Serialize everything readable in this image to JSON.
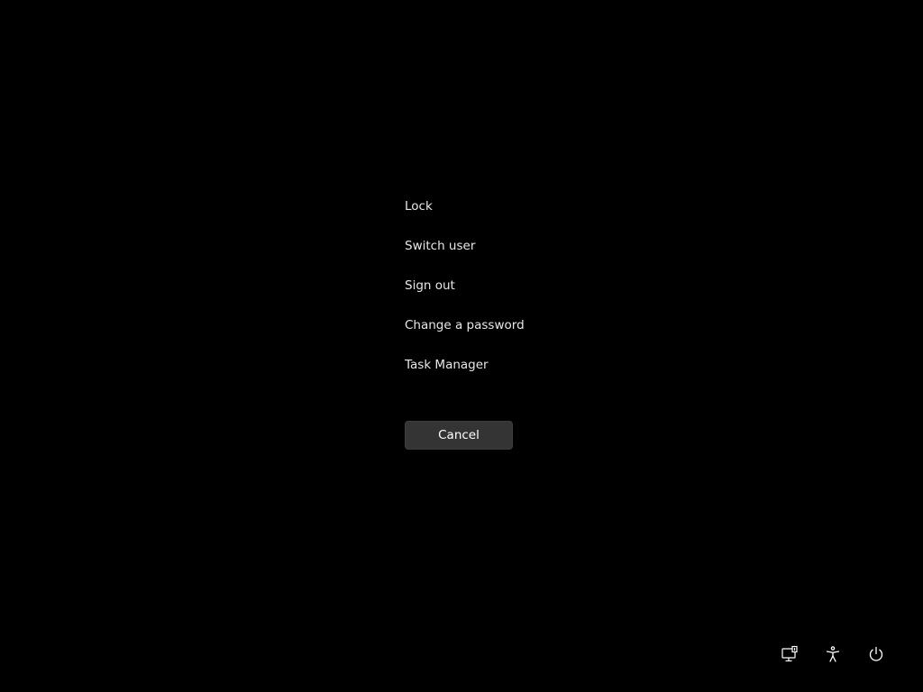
{
  "menu": {
    "items": [
      {
        "id": "lock",
        "label": "Lock"
      },
      {
        "id": "switch-user",
        "label": "Switch user"
      },
      {
        "id": "sign-out",
        "label": "Sign out"
      },
      {
        "id": "change-password",
        "label": "Change a password"
      },
      {
        "id": "task-manager",
        "label": "Task Manager"
      }
    ]
  },
  "cancel": {
    "label": "Cancel"
  },
  "tray": {
    "icons": [
      "network-icon",
      "accessibility-icon",
      "power-icon"
    ]
  },
  "colors": {
    "background": "#000000",
    "text": "#e8e8e8",
    "button": "#343434"
  }
}
